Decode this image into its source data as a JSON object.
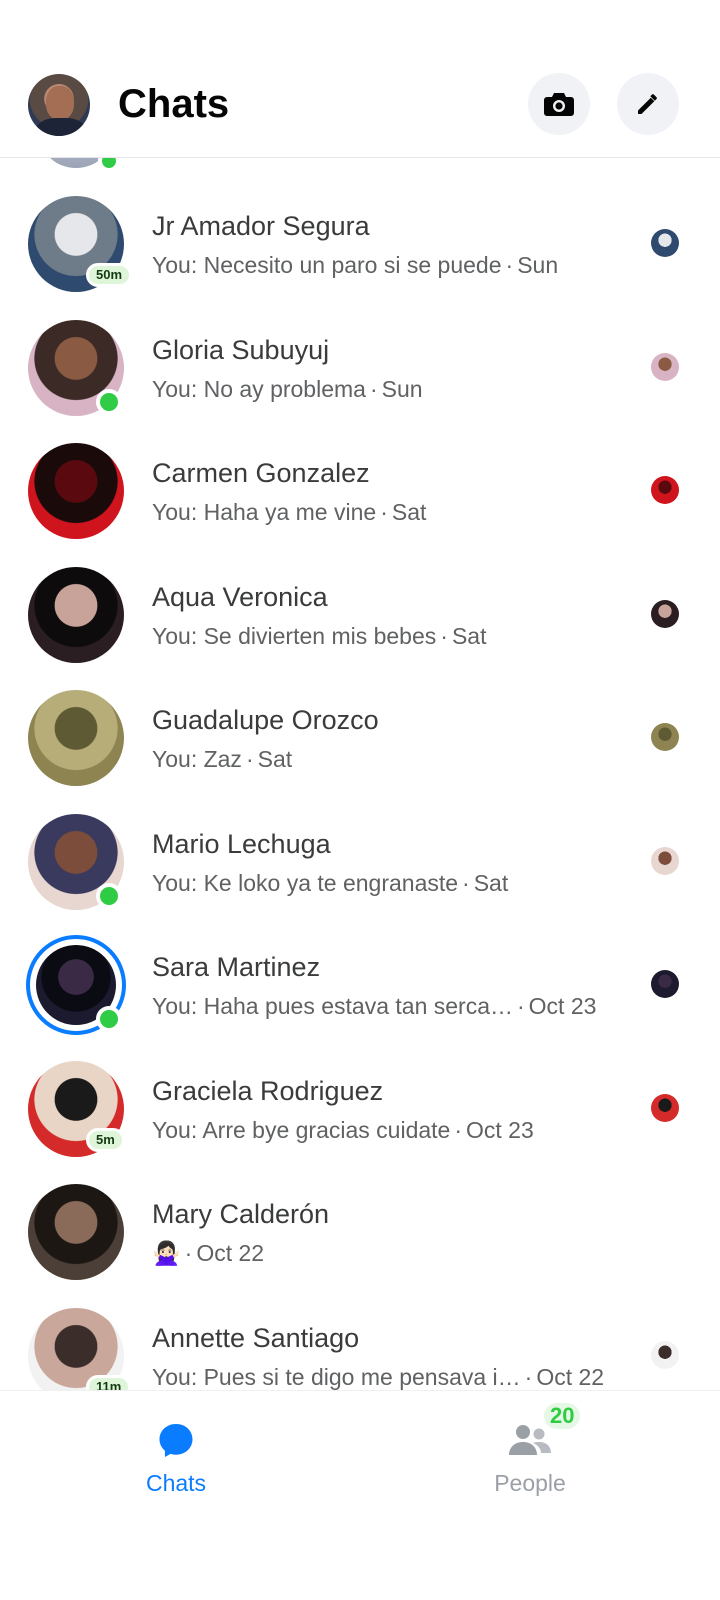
{
  "header": {
    "title": "Chats",
    "camera_icon": "camera-icon",
    "compose_icon": "pencil-icon"
  },
  "chats": [
    {
      "name": "Jr Amador Segura",
      "message": "You: Necesito un paro si se puede",
      "time": "Sun",
      "badge": "50m",
      "online": false,
      "story": false,
      "colors": [
        "#2f4a6f",
        "#e5e7ea",
        "#6e7b88"
      ]
    },
    {
      "name": "Gloria Subuyuj",
      "message": "You: No ay problema",
      "time": "Sun",
      "badge": "",
      "online": true,
      "story": false,
      "colors": [
        "#d8b3c3",
        "#8a5a43",
        "#3c2a26"
      ]
    },
    {
      "name": "Carmen Gonzalez",
      "message": "You: Haha ya me vine",
      "time": "Sat",
      "badge": "",
      "online": false,
      "story": false,
      "colors": [
        "#d0141e",
        "#5a0a0e",
        "#1a0a0a"
      ]
    },
    {
      "name": "Aqua Veronica",
      "message": "You: Se divierten mis bebes",
      "time": "Sat",
      "badge": "",
      "online": false,
      "story": false,
      "colors": [
        "#2a1e22",
        "#c7a39a",
        "#0e0b0c"
      ]
    },
    {
      "name": "Guadalupe Orozco",
      "message": "You: Zaz",
      "time": "Sat",
      "badge": "",
      "online": false,
      "story": false,
      "colors": [
        "#8d8452",
        "#5e5a34",
        "#b6ad79"
      ]
    },
    {
      "name": "Mario Lechuga",
      "message": "You: Ke loko ya te engranaste",
      "time": "Sat",
      "badge": "",
      "online": true,
      "story": false,
      "colors": [
        "#e8d6d0",
        "#7c4d3a",
        "#3a3a5e"
      ]
    },
    {
      "name": "Sara Martinez",
      "message": "You: Haha pues estava tan serca…",
      "time": "Oct 23",
      "badge": "",
      "online": true,
      "story": true,
      "colors": [
        "#1c1a2e",
        "#3b2a45",
        "#0b0b14"
      ]
    },
    {
      "name": "Graciela Rodriguez",
      "message": "You: Arre bye gracias cuidate",
      "time": "Oct 23",
      "badge": "5m",
      "online": false,
      "story": false,
      "colors": [
        "#d42a2a",
        "#1a1a1a",
        "#e9d5c6"
      ]
    },
    {
      "name": "Mary Calderón",
      "message": "🙅🏻‍♀️",
      "time": "Oct 22",
      "badge": "",
      "online": false,
      "story": false,
      "colors": [
        "#4b3f37",
        "#8a6a58",
        "#1d1713"
      ]
    },
    {
      "name": "Annette Santiago",
      "message": "You: Pues si te digo me pensava i…",
      "time": "Oct 22",
      "badge": "11m",
      "online": false,
      "story": false,
      "colors": [
        "#f2f2f2",
        "#3b2e2a",
        "#c9a79a"
      ]
    }
  ],
  "nav": {
    "chats_label": "Chats",
    "people_label": "People",
    "people_count": "20"
  },
  "accent": "#0a7cff",
  "online_color": "#31cc46"
}
